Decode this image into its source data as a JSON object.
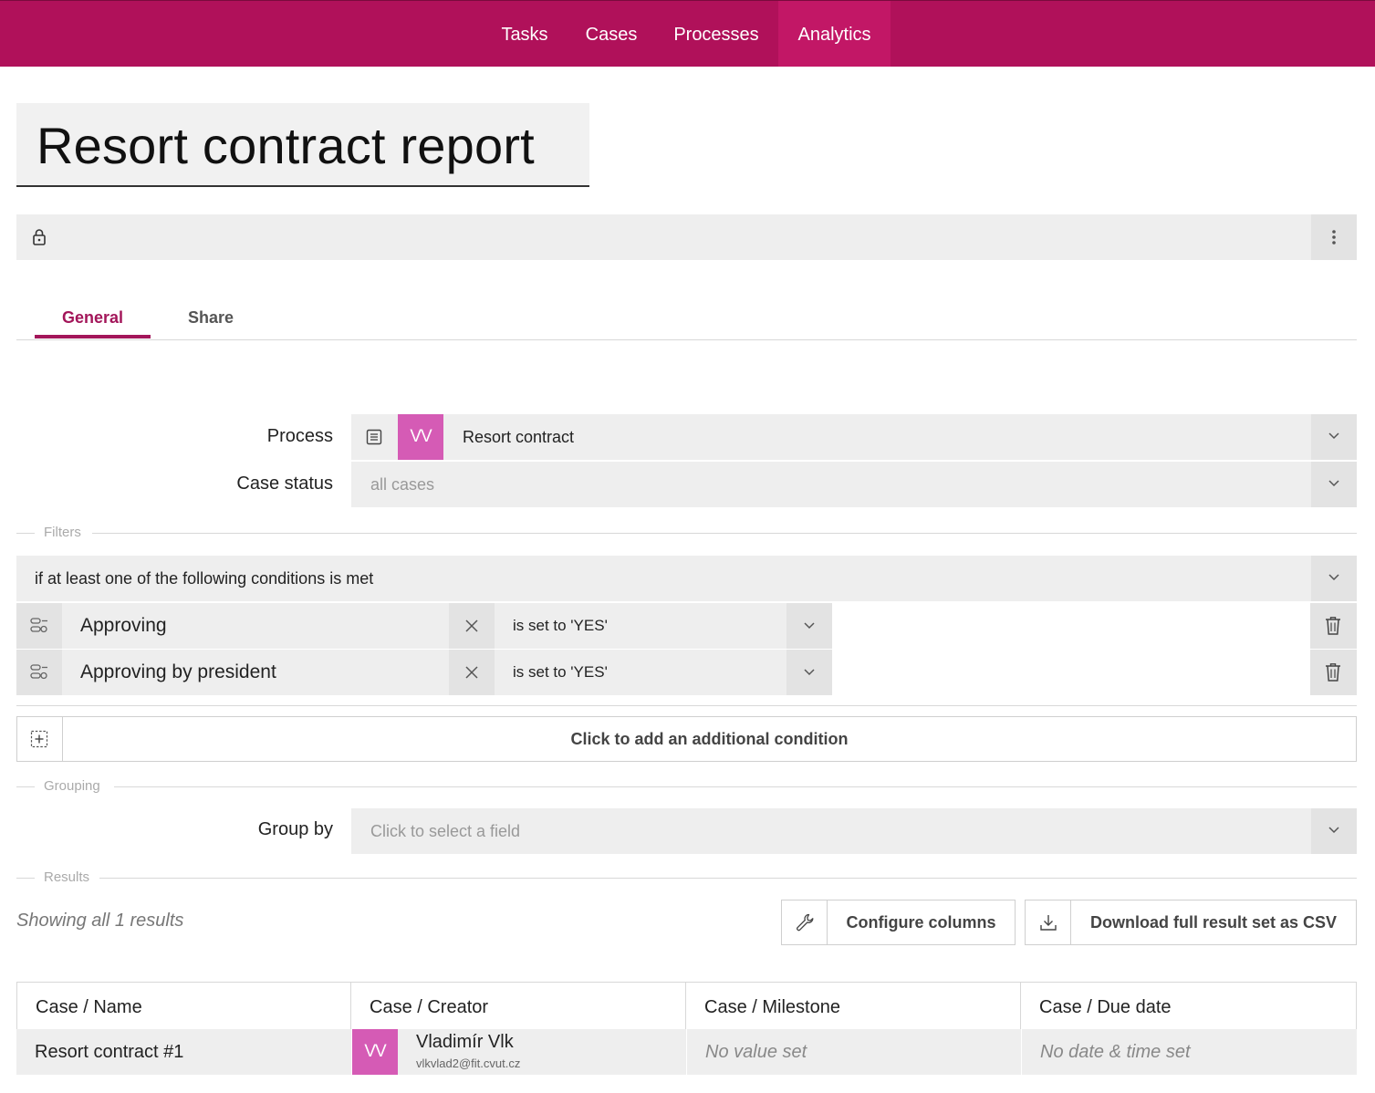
{
  "nav": {
    "items": [
      {
        "label": "Tasks",
        "active": false
      },
      {
        "label": "Cases",
        "active": false
      },
      {
        "label": "Processes",
        "active": false
      },
      {
        "label": "Analytics",
        "active": true
      }
    ],
    "bg_color": "#b0115a",
    "active_color": "#c21766"
  },
  "page": {
    "title": "Resort contract report",
    "lock_icon": "lock-icon",
    "menu_icon": "more-vertical-icon"
  },
  "tabs": [
    {
      "label": "General",
      "active": true
    },
    {
      "label": "Share",
      "active": false
    }
  ],
  "form": {
    "process_label": "Process",
    "process_avatar": "VV",
    "process_value": "Resort contract",
    "case_status_label": "Case status",
    "case_status_placeholder": "all cases"
  },
  "filters": {
    "section_label": "Filters",
    "mode": "if at least one of the following conditions is met",
    "conditions": [
      {
        "field": "Approving",
        "operator": "is set to 'YES'"
      },
      {
        "field": "Approving by president",
        "operator": "is set to 'YES'"
      }
    ],
    "add_label": "Click to add an additional condition"
  },
  "grouping": {
    "section_label": "Grouping",
    "group_by_label": "Group by",
    "group_by_placeholder": "Click to select a field"
  },
  "results": {
    "section_label": "Results",
    "showing": "Showing all 1 results",
    "configure_label": "Configure columns",
    "download_label": "Download full result set as CSV",
    "columns": [
      "Case / Name",
      "Case / Creator",
      "Case / Milestone",
      "Case / Due date"
    ],
    "rows": [
      {
        "name": "Resort contract #1",
        "creator_avatar": "VV",
        "creator_name": "Vladimír Vlk",
        "creator_email": "vlkvlad2@fit.cvut.cz",
        "milestone": "No value set",
        "due_date": "No date & time set"
      }
    ]
  },
  "colors": {
    "accent": "#a3165a",
    "avatar": "#d55bb5"
  }
}
